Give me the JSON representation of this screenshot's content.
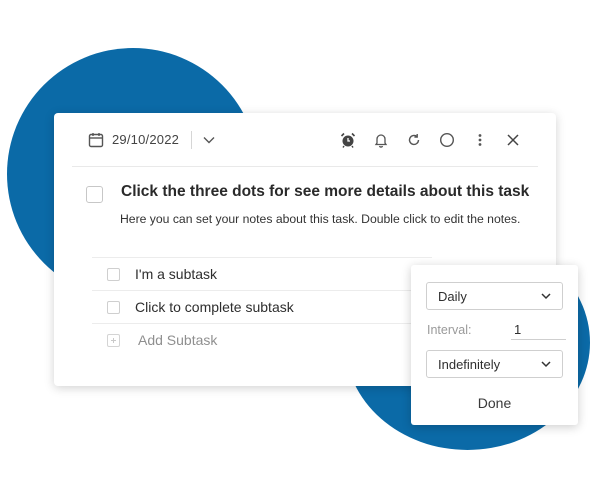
{
  "colors": {
    "accent_blue": "#0b6aa7"
  },
  "toolbar": {
    "date": "29/10/2022",
    "icons": [
      "calendar-icon",
      "chevron-down-icon",
      "alarm-clock-icon",
      "bell-icon",
      "refresh-icon",
      "circle-icon",
      "more-vertical-icon",
      "close-icon"
    ]
  },
  "task": {
    "title": "Click the three dots for see more details about this task",
    "notes": "Here you can set your notes about this task. Double click to edit the notes."
  },
  "subtasks": {
    "items": [
      {
        "label": "I'm a subtask"
      },
      {
        "label": "Click to complete subtask"
      }
    ],
    "add_label": "Add Subtask"
  },
  "repeat_popup": {
    "frequency": "Daily",
    "interval_label": "Interval:",
    "interval_value": "1",
    "end": "Indefinitely",
    "done_label": "Done"
  }
}
